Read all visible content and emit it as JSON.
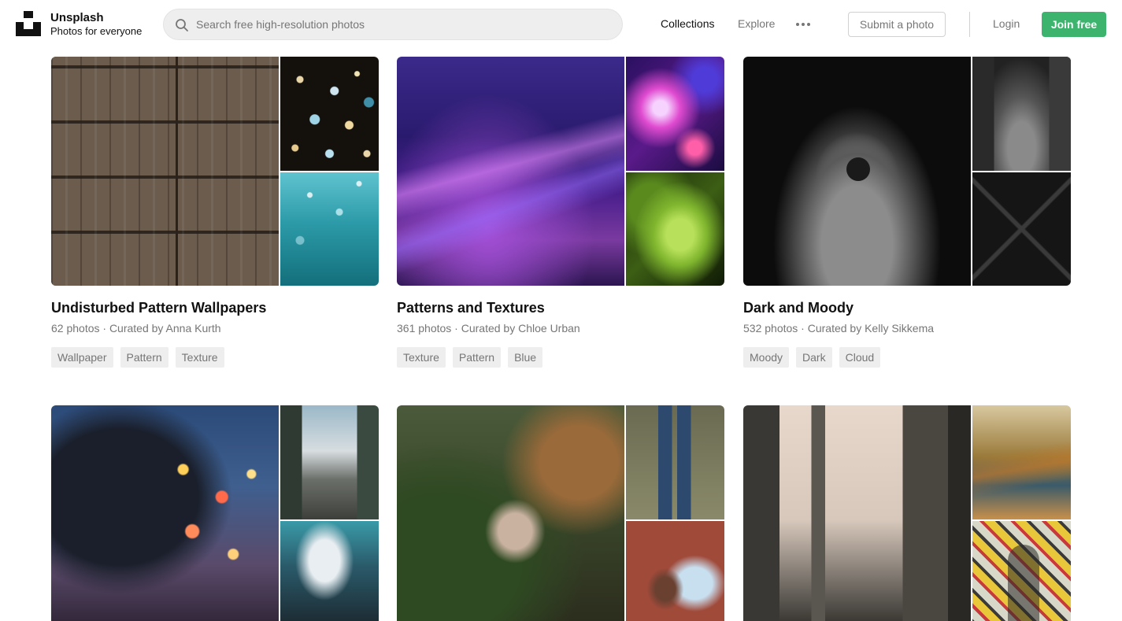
{
  "header": {
    "brand_name": "Unsplash",
    "brand_tagline": "Photos for everyone",
    "search_placeholder": "Search free high-resolution photos",
    "nav": {
      "collections": "Collections",
      "explore": "Explore"
    },
    "submit_label": "Submit a photo",
    "login_label": "Login",
    "join_label": "Join free",
    "join_color": "#3cb46e"
  },
  "collections": [
    {
      "title": "Undisturbed Pattern Wallpapers",
      "meta": "62 photos · Curated by Anna Kurth",
      "tags": [
        "Wallpaper",
        "Pattern",
        "Texture"
      ],
      "photos": [
        "weathered wooden door",
        "golden and blue bokeh lights",
        "turquoise water with bubbles"
      ]
    },
    {
      "title": "Patterns and Textures",
      "meta": "361 photos · Curated by Chloe Urban",
      "tags": [
        "Texture",
        "Pattern",
        "Blue"
      ],
      "photos": [
        "purple motion blur abstract",
        "pink and magenta light bokeh",
        "green leaves close-up"
      ]
    },
    {
      "title": "Dark and Moody",
      "meta": "532 photos · Curated by Kelly Sikkema",
      "tags": [
        "Moody",
        "Dark",
        "Cloud"
      ],
      "photos": [
        "person in grey hoodie on black",
        "dark concrete corridor",
        "dark architectural lines"
      ]
    },
    {
      "photos": [
        "person with umbrella in rainy night city",
        "narrow city street with palm trees",
        "crowd with clear umbrellas"
      ]
    },
    {
      "photos": [
        "child among plants in greenhouse",
        "person in jeans standing on stool",
        "person reclining on red background"
      ]
    },
    {
      "photos": [
        "city street between tall buildings",
        "motion-blurred autumn trees",
        "graffiti wall with passerby"
      ]
    }
  ]
}
